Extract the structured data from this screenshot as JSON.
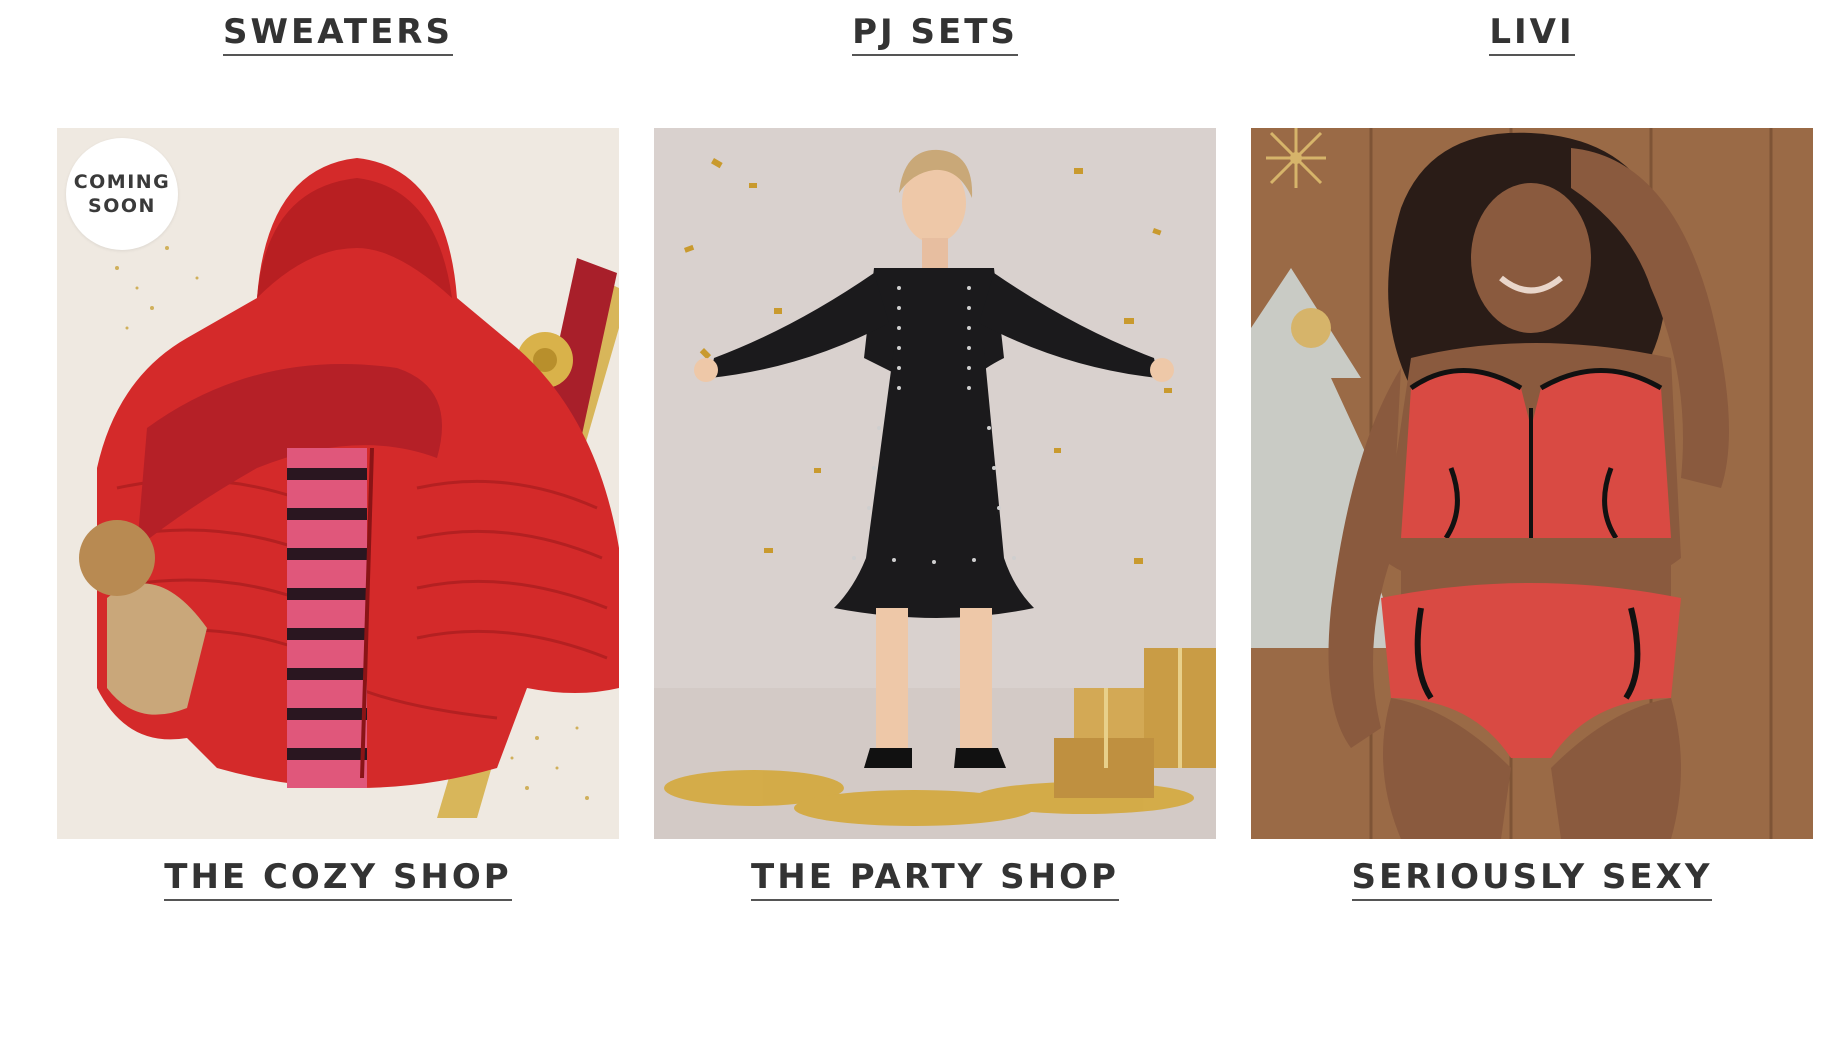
{
  "top_categories": [
    {
      "label": "SWEATERS"
    },
    {
      "label": "PJ SETS"
    },
    {
      "label": "LIVI"
    }
  ],
  "tiles": [
    {
      "image": "red-puffer-jacket-photo",
      "badge_line1": "COMING",
      "badge_line2": "SOON",
      "label": "THE COZY SHOP"
    },
    {
      "image": "woman-black-studded-dress-photo",
      "label": "THE PARTY SHOP"
    },
    {
      "image": "woman-red-lingerie-photo",
      "label": "SERIOUSLY SEXY"
    }
  ],
  "colors": {
    "text": "#333333",
    "underline": "#555555",
    "accent_red": "#d42a2a",
    "gold": "#c9a23a"
  }
}
